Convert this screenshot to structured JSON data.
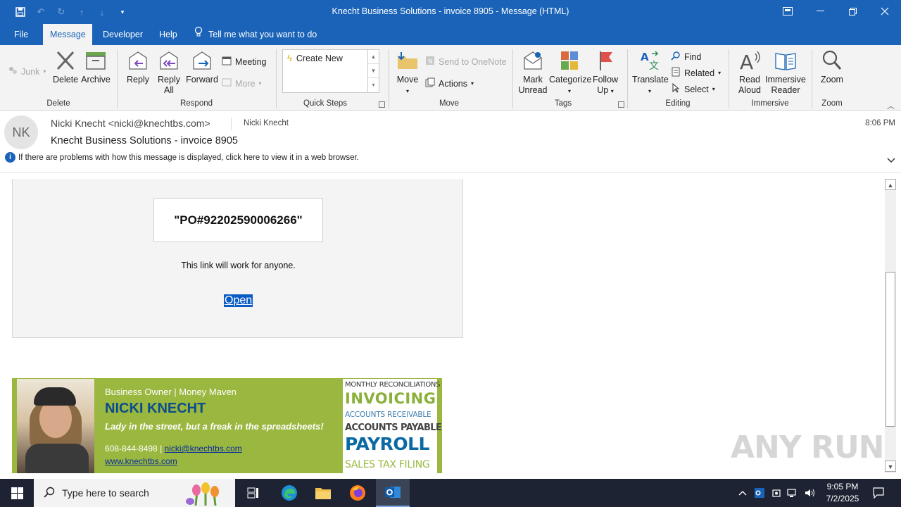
{
  "window": {
    "title": "Knecht Business Solutions - invoice 8905  -  Message (HTML)"
  },
  "tabs": {
    "file": "File",
    "message": "Message",
    "developer": "Developer",
    "help": "Help",
    "tell_me": "Tell me what you want to do"
  },
  "ribbon": {
    "junk": "Junk",
    "delete": "Delete",
    "archive": "Archive",
    "group_delete": "Delete",
    "reply": "Reply",
    "reply_all_1": "Reply",
    "reply_all_2": "All",
    "forward": "Forward",
    "meeting": "Meeting",
    "more": "More",
    "group_respond": "Respond",
    "create_new": "Create New",
    "group_quick_steps": "Quick Steps",
    "move": "Move",
    "send_onenote": "Send to OneNote",
    "actions": "Actions",
    "group_move": "Move",
    "mark_unread_1": "Mark",
    "mark_unread_2": "Unread",
    "categorize": "Categorize",
    "follow_up_1": "Follow",
    "follow_up_2": "Up",
    "group_tags": "Tags",
    "translate": "Translate",
    "find": "Find",
    "related": "Related",
    "select": "Select",
    "group_editing": "Editing",
    "read_aloud_1": "Read",
    "read_aloud_2": "Aloud",
    "immersive_1": "Immersive",
    "immersive_2": "Reader",
    "group_immersive": "Immersive",
    "zoom": "Zoom",
    "group_zoom": "Zoom"
  },
  "message": {
    "initials": "NK",
    "from": "Nicki Knecht <nicki@knechtbs.com>",
    "to": "Nicki Knecht",
    "subject": "Knecht Business Solutions - invoice 8905",
    "time": "8:06 PM",
    "info_bar": "If there are problems with how this message is displayed, click here to view it in a web browser."
  },
  "body": {
    "po_number": "\"PO#92202590006266\"",
    "link_text": "This link will work for anyone.",
    "open_link": "Open"
  },
  "signature": {
    "role": "Business Owner | Money Maven",
    "name": "NICKI KNECHT",
    "quote": "Lady in the street, but a freak in the spreadsheets!",
    "phone": "608-844-8498 | ",
    "email": "nicki@knechtbs.com",
    "website": "www.knechtbs.com",
    "services": [
      "MONTHLY RECONCILIATIONS",
      "INVOICING",
      "ACCOUNTS RECEIVABLE",
      "ACCOUNTS PAYABLE",
      "PAYROLL",
      "SALES TAX FILING"
    ]
  },
  "watermark": "ANY RUN",
  "taskbar": {
    "search_placeholder": "Type here to search",
    "time": "9:05 PM",
    "date": "7/2/2025"
  },
  "colors": {
    "title_bar": "#1a63b8",
    "ribbon_bg": "#f3f3f3",
    "signature_green": "#9ab73f",
    "signature_blue": "#0b4c8c",
    "taskbar": "#1d2333"
  }
}
